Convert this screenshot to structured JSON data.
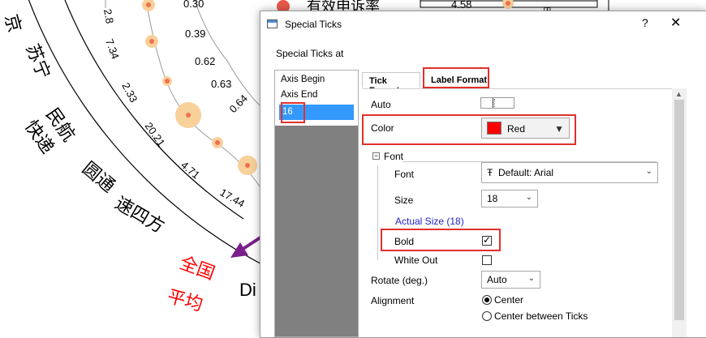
{
  "background": {
    "chart_labels": [
      "京",
      "苏宁",
      "民航",
      "快递",
      "圆通",
      "速四方",
      "全国",
      "平均",
      "Di"
    ],
    "values": [
      "2.8",
      "0.30",
      "0.39",
      "7.34",
      "0.62",
      "2.33",
      "0.63",
      "20.21",
      "0.64",
      "4.71",
      "17.44"
    ],
    "top_right": {
      "legend_text": "有效申诉率",
      "box_value": "4.58",
      "small_value": "8"
    },
    "highlight_color": "#ff0000"
  },
  "dialog": {
    "title": "Special Ticks",
    "help_label": "?",
    "close_label": "✕",
    "section_label": "Special Ticks at",
    "list_items": [
      "Axis Begin",
      "Axis End",
      "16"
    ],
    "tabs": {
      "tick_format": "Tick Format",
      "label_format": "Label Format"
    },
    "fields": {
      "auto_label": "Auto",
      "color_label": "Color",
      "color_value": "Red",
      "color_hex": "#ff0000",
      "font_group_label": "Font",
      "font_label": "Font",
      "font_value": "Default: Arial",
      "size_label": "Size",
      "size_value": "18",
      "actual_size_link": "Actual Size (18)",
      "bold_label": "Bold",
      "bold_checked": true,
      "white_out_label": "White Out",
      "white_out_checked": false,
      "rotate_label": "Rotate (deg.)",
      "rotate_value": "Auto",
      "alignment_label": "Alignment",
      "alignment_options": [
        "Center",
        "Center between Ticks"
      ],
      "alignment_selected": "Center"
    },
    "annotation_color": "#e0312c",
    "arrow_color": "#7a1e8c"
  }
}
